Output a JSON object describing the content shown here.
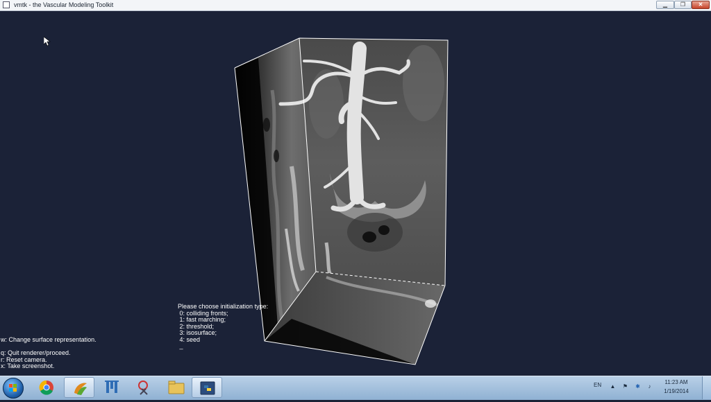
{
  "window": {
    "title": "vmtk - the Vascular Modeling Toolkit",
    "minimize_icon": "minimize-icon",
    "maximize_icon": "restore-icon",
    "close_icon": "close-icon"
  },
  "viewport": {
    "background_color": "#1b2237",
    "menu_text": "Please choose initialization type:\n 0: colliding fronts;\n 1: fast marching;\n 2: threshold;\n 3: isosurface;\n 4: seed\n _",
    "help_text": "w: Change surface representation.\n\nq: Quit renderer/proceed.\nr: Reset camera.\nx: Take screenshot."
  },
  "taskbar": {
    "items": [
      {
        "icon": "chrome-icon"
      },
      {
        "icon": "vmtk-icon",
        "active": true
      },
      {
        "icon": "fiji-icon"
      },
      {
        "icon": "snipping-tool-icon"
      },
      {
        "icon": "file-explorer-icon"
      },
      {
        "icon": "python-icon",
        "active": true
      }
    ],
    "language": "EN",
    "clock_time": "11:23 AM",
    "clock_date": "1/19/2014"
  }
}
